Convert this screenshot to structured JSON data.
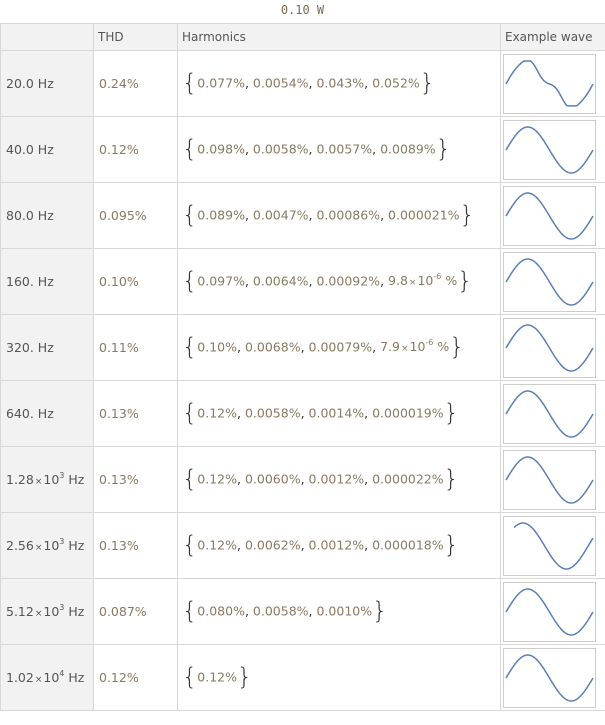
{
  "title": "0.10 W",
  "headers": {
    "freq": "",
    "thd": "THD",
    "harmonics": "Harmonics",
    "wave": "Example wave"
  },
  "wave_color": "#5b7fb5",
  "rows": [
    {
      "freq": "20.0 Hz",
      "thd": "0.24%",
      "harmonics": [
        "0.077%",
        "0.0054%",
        "0.043%",
        "0.052%"
      ],
      "wave": "distorted"
    },
    {
      "freq": "40.0 Hz",
      "thd": "0.12%",
      "harmonics": [
        "0.098%",
        "0.0058%",
        "0.0057%",
        "0.0089%"
      ],
      "wave": "sine"
    },
    {
      "freq": "80.0 Hz",
      "thd": "0.095%",
      "harmonics": [
        "0.089%",
        "0.0047%",
        "0.00086%",
        "0.000021%"
      ],
      "wave": "sine"
    },
    {
      "freq": "160. Hz",
      "thd": "0.10%",
      "harmonics": [
        "0.097%",
        "0.0064%",
        "0.00092%",
        "9.8 × 10^-6 %"
      ],
      "wave": "sine"
    },
    {
      "freq": "320. Hz",
      "thd": "0.11%",
      "harmonics": [
        "0.10%",
        "0.0068%",
        "0.00079%",
        "7.9 × 10^-6 %"
      ],
      "wave": "sine"
    },
    {
      "freq": "640. Hz",
      "thd": "0.13%",
      "harmonics": [
        "0.12%",
        "0.0058%",
        "0.0014%",
        "0.000019%"
      ],
      "wave": "sine"
    },
    {
      "freq": "1.28 × 10^3 Hz",
      "thd": "0.13%",
      "harmonics": [
        "0.12%",
        "0.0060%",
        "0.0012%",
        "0.000022%"
      ],
      "wave": "sine"
    },
    {
      "freq": "2.56 × 10^3 Hz",
      "thd": "0.13%",
      "harmonics": [
        "0.12%",
        "0.0062%",
        "0.0012%",
        "0.000018%"
      ],
      "wave": "sine-short"
    },
    {
      "freq": "5.12 × 10^3 Hz",
      "thd": "0.087%",
      "harmonics": [
        "0.080%",
        "0.0058%",
        "0.0010%"
      ],
      "wave": "sine"
    },
    {
      "freq": "1.02 × 10^4 Hz",
      "thd": "0.12%",
      "harmonics": [
        "0.12%"
      ],
      "wave": "sine"
    }
  ]
}
